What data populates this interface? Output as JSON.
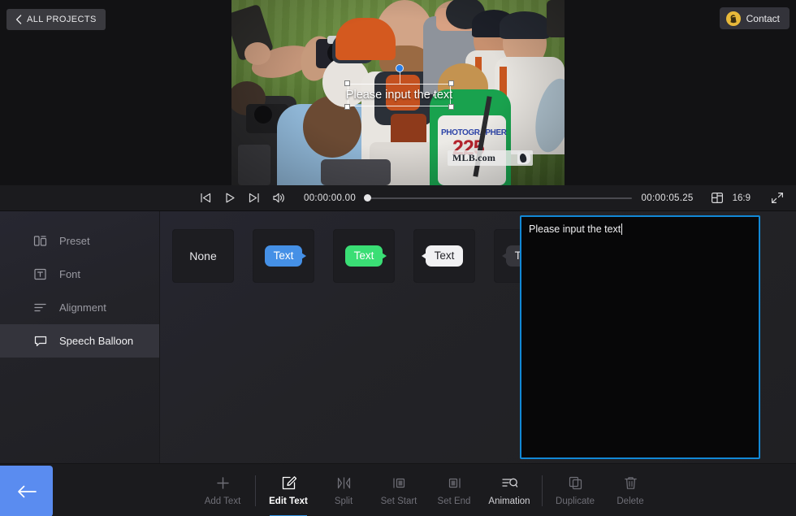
{
  "header": {
    "back_projects_label": "ALL PROJECTS",
    "back_projects_icon": "chevron-left-icon",
    "contact_label": "Contact",
    "contact_icon": "user-avatar-icon"
  },
  "preview": {
    "overlay_text": "Please input the text",
    "watermark": "MLB.com",
    "scene_description": "baseball celebration"
  },
  "player": {
    "prev_frame_icon": "skip-previous-icon",
    "play_icon": "play-icon",
    "next_frame_icon": "skip-next-icon",
    "volume_icon": "volume-icon",
    "current_time": "00:00:00.00",
    "duration": "00:00:05.25",
    "aspect_icon": "aspect-ratio-icon",
    "aspect_ratio": "16:9",
    "fullscreen_icon": "fullscreen-icon",
    "progress_percent": 0
  },
  "sidebar": {
    "items": [
      {
        "label": "Preset",
        "icon": "preset-icon",
        "active": false
      },
      {
        "label": "Font",
        "icon": "font-icon",
        "active": false
      },
      {
        "label": "Alignment",
        "icon": "alignment-icon",
        "active": false
      },
      {
        "label": "Speech Balloon",
        "icon": "speech-balloon-icon",
        "active": true
      }
    ]
  },
  "presets": {
    "items": [
      {
        "label": "None",
        "style": "none",
        "fill": "",
        "text_color": ""
      },
      {
        "label": "Text",
        "style": "balloon-right",
        "fill": "#4590e6",
        "text_color": "#ffffff"
      },
      {
        "label": "Text",
        "style": "balloon-right",
        "fill": "#3ade75",
        "text_color": "#ffffff"
      },
      {
        "label": "Text",
        "style": "balloon-left",
        "fill": "#f1f1f3",
        "text_color": "#26262b"
      },
      {
        "label": "Text",
        "style": "balloon-left",
        "fill": "#36363c",
        "text_color": "#e6e6ea"
      }
    ]
  },
  "text_editor": {
    "value": "Please input the text",
    "placeholder": "Please input the text",
    "focus_color": "#1288d6"
  },
  "toolbar": {
    "back_icon": "arrow-left-icon",
    "tools": [
      {
        "label": "Add Text",
        "icon": "plus-icon",
        "state": "disabled"
      },
      {
        "label": "Edit Text",
        "icon": "edit-pencil-icon",
        "state": "active"
      },
      {
        "label": "Split",
        "icon": "split-icon",
        "state": "disabled"
      },
      {
        "label": "Set Start",
        "icon": "set-start-icon",
        "state": "disabled"
      },
      {
        "label": "Set End",
        "icon": "set-end-icon",
        "state": "disabled"
      },
      {
        "label": "Animation",
        "icon": "animation-icon",
        "state": "enabled"
      },
      {
        "label": "Duplicate",
        "icon": "duplicate-icon",
        "state": "disabled"
      },
      {
        "label": "Delete",
        "icon": "trash-icon",
        "state": "disabled"
      }
    ]
  },
  "colors": {
    "accent_blue": "#2e8fe0",
    "back_button_blue": "#5a8cf0",
    "panel_bg": "#232327",
    "bar_bg": "#1b1b1e"
  }
}
